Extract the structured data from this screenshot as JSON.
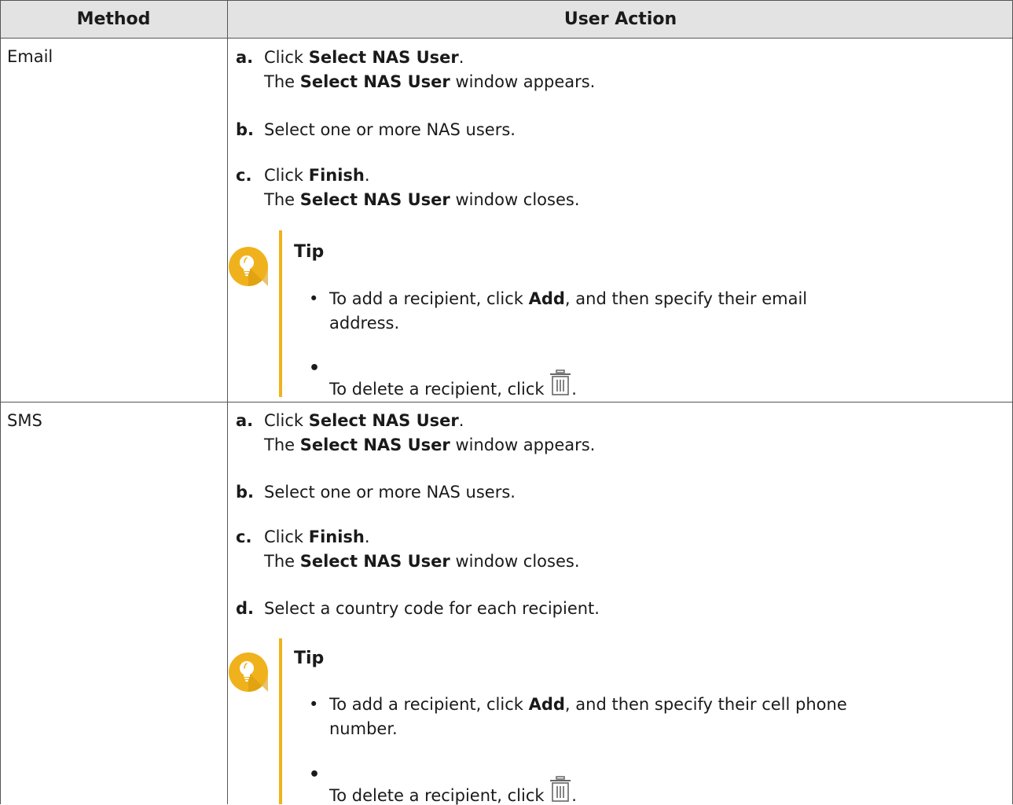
{
  "header": {
    "method": "Method",
    "user_action": "User Action"
  },
  "rows": [
    {
      "method": "Email",
      "steps": [
        {
          "letter": "a.",
          "pre": "Click ",
          "bold": "Select NAS User",
          "post": ".",
          "line2_pre": "The ",
          "line2_bold": "Select NAS User",
          "line2_post": " window appears."
        },
        {
          "letter": "b.",
          "text": "Select one or more NAS users."
        },
        {
          "letter": "c.",
          "pre": "Click ",
          "bold": "Finish",
          "post": ".",
          "line2_pre": "The ",
          "line2_bold": "Select NAS User",
          "line2_post": " window closes."
        }
      ],
      "tip": {
        "title": "Tip",
        "bullet1_pre": "To add a recipient, click ",
        "bullet1_bold": "Add",
        "bullet1_post": ", and then specify their email",
        "bullet1_line2": "address.",
        "bullet2_text": "To delete a recipient, click ",
        "bullet2_post": "."
      }
    },
    {
      "method": "SMS",
      "steps": [
        {
          "letter": "a.",
          "pre": "Click ",
          "bold": "Select NAS User",
          "post": ".",
          "line2_pre": "The ",
          "line2_bold": "Select NAS User",
          "line2_post": " window appears."
        },
        {
          "letter": "b.",
          "text": "Select one or more NAS users."
        },
        {
          "letter": "c.",
          "pre": "Click ",
          "bold": "Finish",
          "post": ".",
          "line2_pre": "The ",
          "line2_bold": "Select NAS User",
          "line2_post": " window closes."
        },
        {
          "letter": "d.",
          "text": "Select a country code for each recipient."
        }
      ],
      "tip": {
        "title": "Tip",
        "bullet1_pre": "To add a recipient, click ",
        "bullet1_bold": "Add",
        "bullet1_post": ", and then specify their cell phone",
        "bullet1_line2": "number.",
        "bullet2_text": "To delete a recipient, click ",
        "bullet2_post": "."
      }
    }
  ],
  "icons": {
    "tip": "lightbulb-icon",
    "delete": "trash-icon",
    "tip_color": "#f0b21c"
  },
  "bullet_char": "•"
}
